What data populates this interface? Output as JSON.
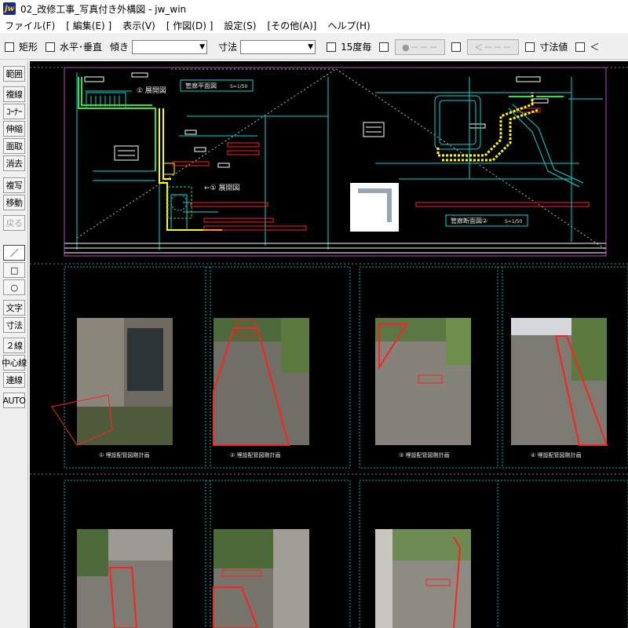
{
  "window": {
    "title": "02_改修工事_写真付き外構図 - jw_win",
    "icon_text": "jw"
  },
  "menu": [
    {
      "label": "ファイル(F)"
    },
    {
      "label": "[ 編集(E) ]"
    },
    {
      "label": "表示(V)"
    },
    {
      "label": "[ 作図(D) ]"
    },
    {
      "label": "設定(S)"
    },
    {
      "label": "[その他(A)]"
    },
    {
      "label": "ヘルプ(H)"
    }
  ],
  "toolbar": {
    "rect_label": "矩形",
    "hv_label": "水平･垂直",
    "tilt_label": "傾き",
    "tilt_value": "",
    "dim_label": "寸法",
    "dim_value": "",
    "deg15_label": "15度毎",
    "pattern_btn": "●－－－",
    "arrow_btn": "＜－－－",
    "dimval_label": "寸法値",
    "lt_label": "＜"
  },
  "tools": [
    {
      "label": "範囲",
      "state": "normal"
    },
    {
      "label": "複線",
      "state": "normal"
    },
    {
      "label": "ｺｰﾅｰ",
      "state": "normal"
    },
    {
      "label": "伸縮",
      "state": "normal"
    },
    {
      "label": "面取",
      "state": "normal"
    },
    {
      "label": "消去",
      "state": "normal"
    },
    {
      "label": "複写",
      "state": "normal"
    },
    {
      "label": "移動",
      "state": "normal"
    },
    {
      "label": "戻る",
      "state": "disabled"
    },
    {
      "label": "／",
      "state": "selected"
    },
    {
      "label": "□",
      "state": "normal"
    },
    {
      "label": "○",
      "state": "normal"
    },
    {
      "label": "文字",
      "state": "normal"
    },
    {
      "label": "寸法",
      "state": "normal"
    },
    {
      "label": "２線",
      "state": "normal"
    },
    {
      "label": "中心線",
      "state": "normal"
    },
    {
      "label": "連線",
      "state": "normal"
    },
    {
      "label": "AUTO",
      "state": "normal"
    }
  ],
  "drawing": {
    "plan_label": "① 展開図",
    "plan_label2": "←① 展開図",
    "top_title": "管廊平面図",
    "top_scale": "S=1/50",
    "section_title": "管廊断面図②",
    "section_scale": "S=1/50",
    "photo_captions": [
      "① 埋設配管図剛計画",
      "② 埋設配管図剛計画",
      "③ 埋設配管図剛計画",
      "④ 埋設配管図剛計画"
    ]
  },
  "colors": {
    "canvas": "#000000",
    "cyan": "#00e5e5",
    "yellow": "#ffff00",
    "red": "#ff2020",
    "green": "#38e038",
    "magenta": "#c040c0"
  }
}
